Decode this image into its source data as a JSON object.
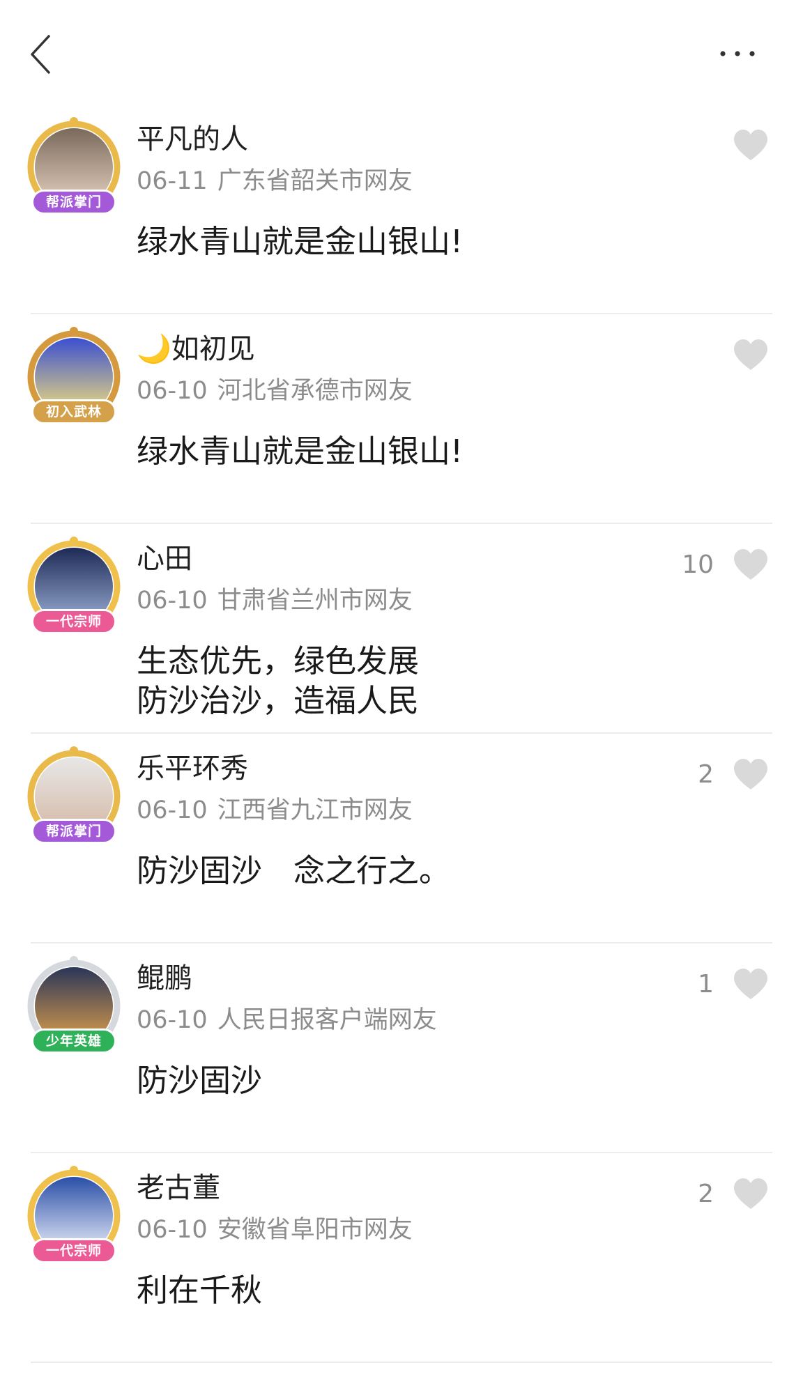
{
  "header": {
    "back_icon": "chevron-left-icon",
    "more_icon": "more-dots-icon"
  },
  "colors": {
    "badge_purple": "#a45ad8",
    "badge_gold": "#d4a04a",
    "badge_pink": "#ec5a96",
    "badge_green": "#2fb15a",
    "heart_gray": "#d9d9d9",
    "meta_gray": "#8c8c8c"
  },
  "comments": [
    {
      "name": "平凡的人",
      "date": "06-11",
      "location": "广东省韶关市网友",
      "text": "绿水青山就是金山银山!",
      "likes": "",
      "badge": "帮派掌门",
      "badge_color": "#a45ad8",
      "frame_color": "#e9b94a",
      "avatar_colors": [
        "#7a6a5c",
        "#e8d2c0"
      ]
    },
    {
      "name": "🌙如初见",
      "date": "06-10",
      "location": "河北省承德市网友",
      "text": "绿水青山就是金山银山!",
      "likes": "",
      "badge": "初入武林",
      "badge_color": "#d4a04a",
      "frame_color": "#d69a3e",
      "avatar_colors": [
        "#3b4fd0",
        "#f5e37a"
      ]
    },
    {
      "name": "心田",
      "date": "06-10",
      "location": "甘肃省兰州市网友",
      "text": "生态优先，绿色发展\n防沙治沙，造福人民",
      "likes": "10",
      "badge": "一代宗师",
      "badge_color": "#ec5a96",
      "frame_color": "#f0c04c",
      "avatar_colors": [
        "#1d2a55",
        "#9fb3d9"
      ]
    },
    {
      "name": "乐平环秀",
      "date": "06-10",
      "location": "江西省九江市网友",
      "text": "防沙固沙　念之行之。",
      "likes": "2",
      "badge": "帮派掌门",
      "badge_color": "#a45ad8",
      "frame_color": "#e9b94a",
      "avatar_colors": [
        "#e7e7e7",
        "#d4b7a3"
      ]
    },
    {
      "name": "鲲鹏",
      "date": "06-10",
      "location": "人民日报客户端网友",
      "text": "防沙固沙",
      "likes": "1",
      "badge": "少年英雄",
      "badge_color": "#2fb15a",
      "frame_color": "#d5d8dd",
      "avatar_colors": [
        "#2a3658",
        "#e2a14a"
      ]
    },
    {
      "name": "老古董",
      "date": "06-10",
      "location": "安徽省阜阳市网友",
      "text": "利在千秋",
      "likes": "2",
      "badge": "一代宗师",
      "badge_color": "#ec5a96",
      "frame_color": "#f0c04c",
      "avatar_colors": [
        "#2b4fa8",
        "#eef2fb"
      ]
    }
  ]
}
